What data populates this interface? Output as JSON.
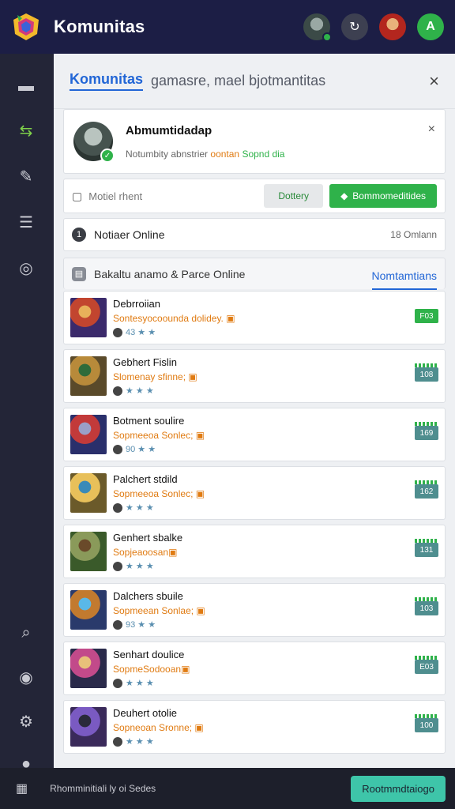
{
  "app": {
    "title": "Komunitas"
  },
  "topbar": {
    "avatar1": "avatar",
    "action_icon": "↻",
    "avatar2": "avatar",
    "green_icon": "A"
  },
  "sidebar": {
    "icons": [
      "inbox-icon",
      "swap-icon",
      "edit-icon",
      "list-icon",
      "target-icon",
      "search-icon",
      "zoom-icon",
      "gear-icon",
      "profile-icon"
    ]
  },
  "panel": {
    "title": "Komunitas",
    "subtitle": "gamasre, mael bjotmantitas",
    "close": "×"
  },
  "profile": {
    "name": "Abmumtidadap",
    "status_prefix": "Notumbity abnstrier",
    "status_accent": "oontan",
    "status_accent2": "Sopnd dia",
    "close": "×"
  },
  "actions": {
    "label": "Motiel rhent",
    "button_grey": "Dottery",
    "button_green": "Bommomeditides"
  },
  "online": {
    "info": "1",
    "label": "Notiaer Online",
    "count": "18 Omlann"
  },
  "list_head": {
    "label": "Bakaltu anamo & Parce Online",
    "tab": "Nomtamtians"
  },
  "items": [
    {
      "name": "Debrroiian",
      "desc": "Sontesyocoounda dolidey. ",
      "meta": "43 ★ ★",
      "badge": "F03",
      "badge_style": "green"
    },
    {
      "name": "Gebhert Fislin",
      "desc": "Slomenay sfinne; ",
      "meta": "★ ★ ★",
      "badge": "108",
      "badge_style": "teal"
    },
    {
      "name": "Botment soulire",
      "desc": "Sopmeeoa Sonlec; ",
      "meta": "90 ★ ★",
      "badge": "169",
      "badge_style": "teal"
    },
    {
      "name": "Palchert stdild",
      "desc": "Sopmeeoa Sonlec; ",
      "meta": "★ ★ ★",
      "badge": "162",
      "badge_style": "teal"
    },
    {
      "name": "Genhert sbalke",
      "desc": "Sopjeaoosan",
      "meta": "★ ★ ★",
      "badge": "131",
      "badge_style": "teal"
    },
    {
      "name": "Dalchers sbuile",
      "desc": "Sopmeean Sonlae; ",
      "meta": "93 ★ ★",
      "badge": "103",
      "badge_style": "teal"
    },
    {
      "name": "Senhart doulice",
      "desc": "SopmeSodooan",
      "meta": "★ ★ ★",
      "badge": "E03",
      "badge_style": "teal"
    },
    {
      "name": "Deuhert otolie",
      "desc": "Sopneoan Sronne; ",
      "meta": "★ ★ ★",
      "badge": "100",
      "badge_style": "teal"
    }
  ],
  "footer": {
    "text": "Rhomminitiali ly oi Sedes",
    "button": "Rootmmdtaiogo"
  }
}
